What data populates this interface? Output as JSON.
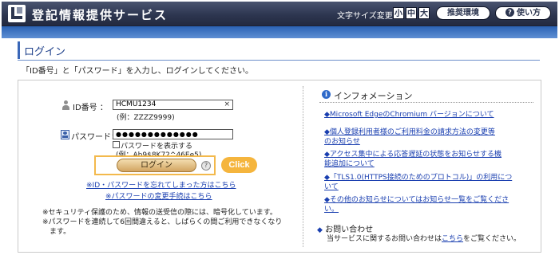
{
  "header": {
    "title": "登記情報提供サービス",
    "font_size_label": "文字サイズ変更",
    "font_sizes": [
      "小",
      "中",
      "大"
    ],
    "recommended_env": "推奨環境",
    "usage": "使い方",
    "help_glyph": "?"
  },
  "page": {
    "title": "ログイン",
    "instruction": "「ID番号」と「パスワード」を入力し、ログインしてください。"
  },
  "login": {
    "id_label": "ID番号 ：",
    "id_value": "HCMU1234",
    "id_clear": "×",
    "id_hint": "(例：ZZZZ9999)",
    "password_label": "パスワード：",
    "password_value": "●●●●●●●●●●●●●",
    "show_password_label": "パスワードを表示する",
    "show_password_checked": false,
    "password_hint": "(例：Ab9$8K72^46Ee5)",
    "login_button": "ログイン",
    "help_glyph": "?",
    "click_badge": "Click",
    "forgot_link": "※ID・パスワードを忘れてしまった方はこちら",
    "change_password_link": "※パスワードの変更手続はこちら",
    "notes": [
      "※セキュリティ保護のため、情報の送受信の際には、暗号化しています。",
      "※パスワードを連続して6回間違えると、しばらくの間ご利用できなくなり",
      "　ます。"
    ]
  },
  "info": {
    "icon": "i",
    "title": "インフォメーション",
    "bullet": "◆",
    "items": [
      "Microsoft EdgeのChromium バージョンについて",
      "個人登録利用者様のご利用料金の請求方法の変更等",
      "のお知らせ",
      "アクセス集中による応答遅延の状態をお知らせする機",
      "能追加について",
      "「TLS1.0(HTTPS接続のためのプロトコル)」の利用につ",
      "いて",
      "その他のお知らせについてはお知らせ一覧をご覧くださ",
      "い。"
    ],
    "contact_title": "お問い合わせ",
    "contact_text_before": "当サービスに関するお問い合わせは",
    "contact_link": "こちら",
    "contact_text_after": "をご覧ください。"
  },
  "colors": {
    "header_bg": "#2d3650",
    "band": "#3a70c2",
    "link": "#1a3fb0",
    "highlight": "#f5b53d"
  }
}
